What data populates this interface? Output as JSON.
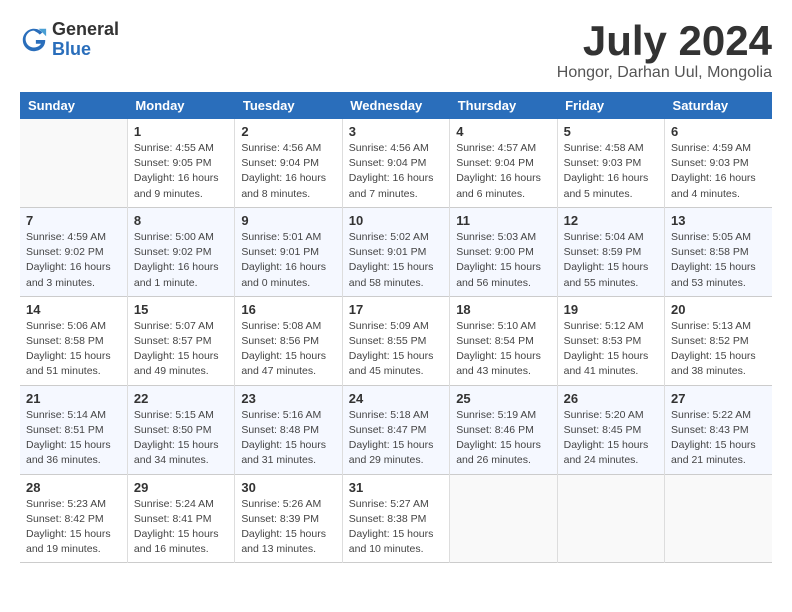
{
  "header": {
    "logo_general": "General",
    "logo_blue": "Blue",
    "title": "July 2024",
    "subtitle": "Hongor, Darhan Uul, Mongolia"
  },
  "calendar": {
    "weekdays": [
      "Sunday",
      "Monday",
      "Tuesday",
      "Wednesday",
      "Thursday",
      "Friday",
      "Saturday"
    ],
    "weeks": [
      [
        {
          "day": "",
          "info": ""
        },
        {
          "day": "1",
          "info": "Sunrise: 4:55 AM\nSunset: 9:05 PM\nDaylight: 16 hours\nand 9 minutes."
        },
        {
          "day": "2",
          "info": "Sunrise: 4:56 AM\nSunset: 9:04 PM\nDaylight: 16 hours\nand 8 minutes."
        },
        {
          "day": "3",
          "info": "Sunrise: 4:56 AM\nSunset: 9:04 PM\nDaylight: 16 hours\nand 7 minutes."
        },
        {
          "day": "4",
          "info": "Sunrise: 4:57 AM\nSunset: 9:04 PM\nDaylight: 16 hours\nand 6 minutes."
        },
        {
          "day": "5",
          "info": "Sunrise: 4:58 AM\nSunset: 9:03 PM\nDaylight: 16 hours\nand 5 minutes."
        },
        {
          "day": "6",
          "info": "Sunrise: 4:59 AM\nSunset: 9:03 PM\nDaylight: 16 hours\nand 4 minutes."
        }
      ],
      [
        {
          "day": "7",
          "info": "Sunrise: 4:59 AM\nSunset: 9:02 PM\nDaylight: 16 hours\nand 3 minutes."
        },
        {
          "day": "8",
          "info": "Sunrise: 5:00 AM\nSunset: 9:02 PM\nDaylight: 16 hours\nand 1 minute."
        },
        {
          "day": "9",
          "info": "Sunrise: 5:01 AM\nSunset: 9:01 PM\nDaylight: 16 hours\nand 0 minutes."
        },
        {
          "day": "10",
          "info": "Sunrise: 5:02 AM\nSunset: 9:01 PM\nDaylight: 15 hours\nand 58 minutes."
        },
        {
          "day": "11",
          "info": "Sunrise: 5:03 AM\nSunset: 9:00 PM\nDaylight: 15 hours\nand 56 minutes."
        },
        {
          "day": "12",
          "info": "Sunrise: 5:04 AM\nSunset: 8:59 PM\nDaylight: 15 hours\nand 55 minutes."
        },
        {
          "day": "13",
          "info": "Sunrise: 5:05 AM\nSunset: 8:58 PM\nDaylight: 15 hours\nand 53 minutes."
        }
      ],
      [
        {
          "day": "14",
          "info": "Sunrise: 5:06 AM\nSunset: 8:58 PM\nDaylight: 15 hours\nand 51 minutes."
        },
        {
          "day": "15",
          "info": "Sunrise: 5:07 AM\nSunset: 8:57 PM\nDaylight: 15 hours\nand 49 minutes."
        },
        {
          "day": "16",
          "info": "Sunrise: 5:08 AM\nSunset: 8:56 PM\nDaylight: 15 hours\nand 47 minutes."
        },
        {
          "day": "17",
          "info": "Sunrise: 5:09 AM\nSunset: 8:55 PM\nDaylight: 15 hours\nand 45 minutes."
        },
        {
          "day": "18",
          "info": "Sunrise: 5:10 AM\nSunset: 8:54 PM\nDaylight: 15 hours\nand 43 minutes."
        },
        {
          "day": "19",
          "info": "Sunrise: 5:12 AM\nSunset: 8:53 PM\nDaylight: 15 hours\nand 41 minutes."
        },
        {
          "day": "20",
          "info": "Sunrise: 5:13 AM\nSunset: 8:52 PM\nDaylight: 15 hours\nand 38 minutes."
        }
      ],
      [
        {
          "day": "21",
          "info": "Sunrise: 5:14 AM\nSunset: 8:51 PM\nDaylight: 15 hours\nand 36 minutes."
        },
        {
          "day": "22",
          "info": "Sunrise: 5:15 AM\nSunset: 8:50 PM\nDaylight: 15 hours\nand 34 minutes."
        },
        {
          "day": "23",
          "info": "Sunrise: 5:16 AM\nSunset: 8:48 PM\nDaylight: 15 hours\nand 31 minutes."
        },
        {
          "day": "24",
          "info": "Sunrise: 5:18 AM\nSunset: 8:47 PM\nDaylight: 15 hours\nand 29 minutes."
        },
        {
          "day": "25",
          "info": "Sunrise: 5:19 AM\nSunset: 8:46 PM\nDaylight: 15 hours\nand 26 minutes."
        },
        {
          "day": "26",
          "info": "Sunrise: 5:20 AM\nSunset: 8:45 PM\nDaylight: 15 hours\nand 24 minutes."
        },
        {
          "day": "27",
          "info": "Sunrise: 5:22 AM\nSunset: 8:43 PM\nDaylight: 15 hours\nand 21 minutes."
        }
      ],
      [
        {
          "day": "28",
          "info": "Sunrise: 5:23 AM\nSunset: 8:42 PM\nDaylight: 15 hours\nand 19 minutes."
        },
        {
          "day": "29",
          "info": "Sunrise: 5:24 AM\nSunset: 8:41 PM\nDaylight: 15 hours\nand 16 minutes."
        },
        {
          "day": "30",
          "info": "Sunrise: 5:26 AM\nSunset: 8:39 PM\nDaylight: 15 hours\nand 13 minutes."
        },
        {
          "day": "31",
          "info": "Sunrise: 5:27 AM\nSunset: 8:38 PM\nDaylight: 15 hours\nand 10 minutes."
        },
        {
          "day": "",
          "info": ""
        },
        {
          "day": "",
          "info": ""
        },
        {
          "day": "",
          "info": ""
        }
      ]
    ]
  }
}
